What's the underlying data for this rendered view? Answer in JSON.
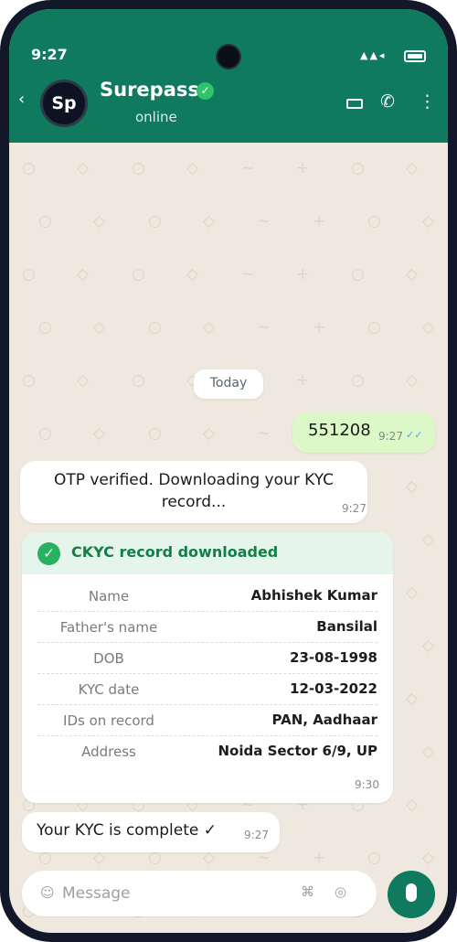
{
  "status_bar": {
    "time": "9:27",
    "signal": "▲▲◂"
  },
  "header": {
    "back_icon": "‹",
    "avatar_initials": "Sp",
    "contact_name": "Surepass",
    "verified_mark": "✓",
    "contact_status": "online",
    "phone_icon": "✆",
    "more_icon": "⋮"
  },
  "chat": {
    "date_label": "Today",
    "outgoing": {
      "text": "551208",
      "time": "9:27",
      "ticks": "✓✓"
    },
    "incoming_1": {
      "text": "OTP verified. Downloading your KYC record...",
      "time": "9:27"
    },
    "card": {
      "check_mark": "✓",
      "title": "CKYC record downloaded",
      "rows": [
        {
          "label": "Name",
          "value": "Abhishek Kumar"
        },
        {
          "label": "Father's name",
          "value": "Bansilal"
        },
        {
          "label": "DOB",
          "value": "23-08-1998"
        },
        {
          "label": "KYC date",
          "value": "12-03-2022"
        },
        {
          "label": "IDs on record",
          "value": "PAN, Aadhaar"
        },
        {
          "label": "Address",
          "value": "Noida Sector 6/9, UP"
        }
      ],
      "time": "9:30"
    },
    "incoming_2": {
      "text": "Your KYC is complete ✓",
      "time": "9:27"
    }
  },
  "composer": {
    "emoji_icon": "☺",
    "placeholder": "Message",
    "attach_icon": "⌘",
    "camera_icon": "◎"
  },
  "colors": {
    "brand": "#0f7a5e",
    "chat_background": "#efe8df",
    "outgoing_bubble": "#dcf8c6",
    "card_header": "#e6f5ec",
    "verified_green": "#27b25f"
  },
  "icons": [
    "back-icon",
    "verified-icon",
    "video-icon",
    "phone-icon",
    "more-icon",
    "check-icon",
    "emoji-icon",
    "attach-icon",
    "camera-icon",
    "mic-icon"
  ]
}
